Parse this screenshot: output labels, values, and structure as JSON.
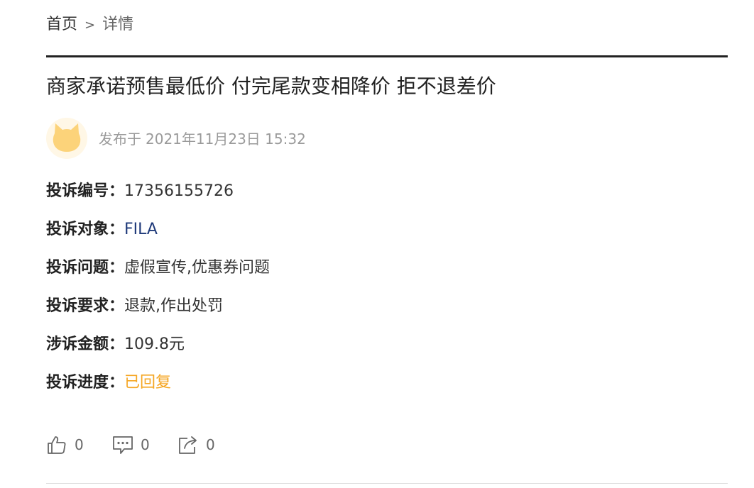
{
  "breadcrumb": {
    "home": "首页",
    "separator": ">",
    "current": "详情"
  },
  "title": "商家承诺预售最低价 付完尾款变相降价 拒不退差价",
  "author": {
    "avatar_icon": "cat-avatar-icon",
    "published_prefix": "发布于",
    "published_date": "2021年11月23日 15:32"
  },
  "details": [
    {
      "label": "投诉编号：",
      "value": "17356155726",
      "style": "plain"
    },
    {
      "label": "投诉对象：",
      "value": "FILA",
      "style": "link"
    },
    {
      "label": "投诉问题：",
      "value": "虚假宣传,优惠券问题",
      "style": "plain"
    },
    {
      "label": "投诉要求：",
      "value": "退款,作出处罚",
      "style": "plain"
    },
    {
      "label": "涉诉金额：",
      "value": "109.8元",
      "style": "plain"
    },
    {
      "label": "投诉进度：",
      "value": "已回复",
      "style": "status"
    }
  ],
  "actions": {
    "like": {
      "icon": "thumbs-up-icon",
      "count": "0"
    },
    "comment": {
      "icon": "comment-icon",
      "count": "0"
    },
    "share": {
      "icon": "share-icon",
      "count": "0"
    }
  },
  "colors": {
    "link": "#1f3a7a",
    "status": "#f5a623",
    "avatar": "#fcd37a"
  }
}
